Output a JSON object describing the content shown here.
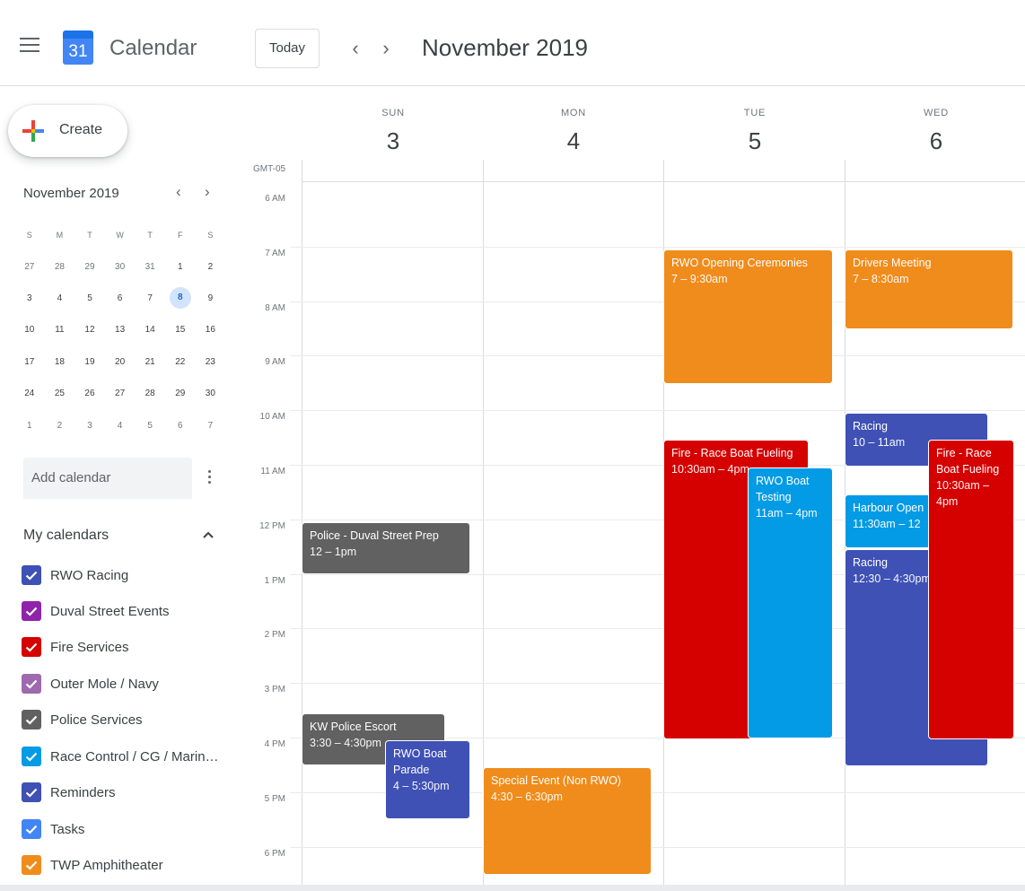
{
  "header": {
    "app_title": "Calendar",
    "logo_day": "31",
    "today_label": "Today",
    "prev_symbol": "‹",
    "next_symbol": "›",
    "month_label": "November 2019"
  },
  "sidebar": {
    "create_label": "Create",
    "mini": {
      "title": "November 2019",
      "prev_symbol": "‹",
      "next_symbol": "›",
      "weekdays": [
        "S",
        "M",
        "T",
        "W",
        "T",
        "F",
        "S"
      ],
      "weeks": [
        [
          "27",
          "28",
          "29",
          "30",
          "31",
          "1",
          "2"
        ],
        [
          "3",
          "4",
          "5",
          "6",
          "7",
          "8",
          "9"
        ],
        [
          "10",
          "11",
          "12",
          "13",
          "14",
          "15",
          "16"
        ],
        [
          "17",
          "18",
          "19",
          "20",
          "21",
          "22",
          "23"
        ],
        [
          "24",
          "25",
          "26",
          "27",
          "28",
          "29",
          "30"
        ],
        [
          "1",
          "2",
          "3",
          "4",
          "5",
          "6",
          "7"
        ]
      ],
      "selected": "8"
    },
    "add_calendar_placeholder": "Add calendar",
    "my_calendars_title": "My calendars",
    "calendars": [
      {
        "label": "RWO Racing",
        "color": "#3f51b5"
      },
      {
        "label": "Duval Street Events",
        "color": "#8e24aa"
      },
      {
        "label": "Fire Services",
        "color": "#d50000"
      },
      {
        "label": "Outer Mole / Navy",
        "color": "#9e69af"
      },
      {
        "label": "Police Services",
        "color": "#616161"
      },
      {
        "label": "Race Control / CG / Marin…",
        "color": "#039be5"
      },
      {
        "label": "Reminders",
        "color": "#3f51b5"
      },
      {
        "label": "Tasks",
        "color": "#4285f4"
      },
      {
        "label": "TWP Amphitheater",
        "color": "#ef8c1c"
      }
    ]
  },
  "grid": {
    "timezone": "GMT-05",
    "days": [
      {
        "dow": "SUN",
        "num": "3"
      },
      {
        "dow": "MON",
        "num": "4"
      },
      {
        "dow": "TUE",
        "num": "5"
      },
      {
        "dow": "WED",
        "num": "6"
      }
    ],
    "hours": [
      "6 AM",
      "7 AM",
      "8 AM",
      "9 AM",
      "10 AM",
      "11 AM",
      "12 PM",
      "1 PM",
      "2 PM",
      "3 PM",
      "4 PM",
      "5 PM",
      "6 PM"
    ]
  },
  "events": [
    {
      "title": "Police - Duval Street Prep",
      "time": "12 – 1pm",
      "color": "#616161"
    },
    {
      "title": "KW Police Escort",
      "time": "3:30 – 4:30pm",
      "color": "#616161"
    },
    {
      "title": "RWO Boat Parade",
      "time": "4 – 5:30pm",
      "color": "#3f51b5"
    },
    {
      "title": "Special Event (Non RWO)",
      "time": "4:30 – 6:30pm",
      "color": "#ef8c1c"
    },
    {
      "title": "RWO Opening Ceremonies",
      "time": "7 – 9:30am",
      "color": "#ef8c1c"
    },
    {
      "title": "Fire - Race Boat Fueling",
      "time": "10:30am – 4pm",
      "color": "#d50000"
    },
    {
      "title": "RWO Boat Testing",
      "time": "11am – 4pm",
      "color": "#039be5"
    },
    {
      "title": "Drivers Meeting",
      "time": "7 – 8:30am",
      "color": "#ef8c1c"
    },
    {
      "title": "Racing",
      "time": "10 – 11am",
      "color": "#3f51b5"
    },
    {
      "title": "Harbour Open",
      "time": "11:30am – 12",
      "color": "#039be5"
    },
    {
      "title": "Racing",
      "time": "12:30 – 4:30pm",
      "color": "#3f51b5"
    },
    {
      "title": "Fire - Race Boat Fueling",
      "time": "10:30am – 4pm",
      "color": "#d50000"
    }
  ],
  "plus_colors": [
    "#ea4335",
    "#fbbc04",
    "#34a853",
    "#4285f4"
  ]
}
